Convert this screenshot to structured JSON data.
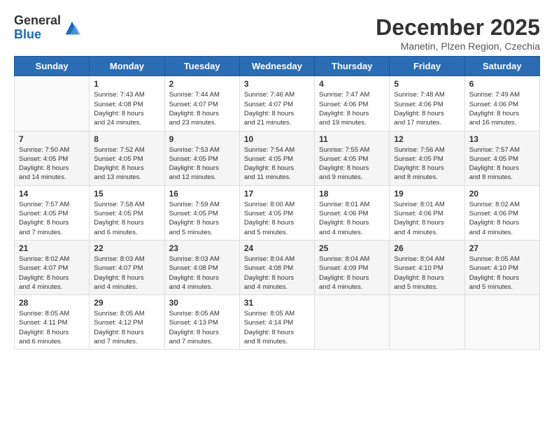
{
  "logo": {
    "general": "General",
    "blue": "Blue"
  },
  "title": "December 2025",
  "subtitle": "Manetin, Plzen Region, Czechia",
  "weekdays": [
    "Sunday",
    "Monday",
    "Tuesday",
    "Wednesday",
    "Thursday",
    "Friday",
    "Saturday"
  ],
  "weeks": [
    [
      {
        "day": "",
        "info": ""
      },
      {
        "day": "1",
        "info": "Sunrise: 7:43 AM\nSunset: 4:08 PM\nDaylight: 8 hours\nand 24 minutes."
      },
      {
        "day": "2",
        "info": "Sunrise: 7:44 AM\nSunset: 4:07 PM\nDaylight: 8 hours\nand 23 minutes."
      },
      {
        "day": "3",
        "info": "Sunrise: 7:46 AM\nSunset: 4:07 PM\nDaylight: 8 hours\nand 21 minutes."
      },
      {
        "day": "4",
        "info": "Sunrise: 7:47 AM\nSunset: 4:06 PM\nDaylight: 8 hours\nand 19 minutes."
      },
      {
        "day": "5",
        "info": "Sunrise: 7:48 AM\nSunset: 4:06 PM\nDaylight: 8 hours\nand 17 minutes."
      },
      {
        "day": "6",
        "info": "Sunrise: 7:49 AM\nSunset: 4:06 PM\nDaylight: 8 hours\nand 16 minutes."
      }
    ],
    [
      {
        "day": "7",
        "info": "Sunrise: 7:50 AM\nSunset: 4:05 PM\nDaylight: 8 hours\nand 14 minutes."
      },
      {
        "day": "8",
        "info": "Sunrise: 7:52 AM\nSunset: 4:05 PM\nDaylight: 8 hours\nand 13 minutes."
      },
      {
        "day": "9",
        "info": "Sunrise: 7:53 AM\nSunset: 4:05 PM\nDaylight: 8 hours\nand 12 minutes."
      },
      {
        "day": "10",
        "info": "Sunrise: 7:54 AM\nSunset: 4:05 PM\nDaylight: 8 hours\nand 11 minutes."
      },
      {
        "day": "11",
        "info": "Sunrise: 7:55 AM\nSunset: 4:05 PM\nDaylight: 8 hours\nand 9 minutes."
      },
      {
        "day": "12",
        "info": "Sunrise: 7:56 AM\nSunset: 4:05 PM\nDaylight: 8 hours\nand 8 minutes."
      },
      {
        "day": "13",
        "info": "Sunrise: 7:57 AM\nSunset: 4:05 PM\nDaylight: 8 hours\nand 8 minutes."
      }
    ],
    [
      {
        "day": "14",
        "info": "Sunrise: 7:57 AM\nSunset: 4:05 PM\nDaylight: 8 hours\nand 7 minutes."
      },
      {
        "day": "15",
        "info": "Sunrise: 7:58 AM\nSunset: 4:05 PM\nDaylight: 8 hours\nand 6 minutes."
      },
      {
        "day": "16",
        "info": "Sunrise: 7:59 AM\nSunset: 4:05 PM\nDaylight: 8 hours\nand 5 minutes."
      },
      {
        "day": "17",
        "info": "Sunrise: 8:00 AM\nSunset: 4:05 PM\nDaylight: 8 hours\nand 5 minutes."
      },
      {
        "day": "18",
        "info": "Sunrise: 8:01 AM\nSunset: 4:06 PM\nDaylight: 8 hours\nand 4 minutes."
      },
      {
        "day": "19",
        "info": "Sunrise: 8:01 AM\nSunset: 4:06 PM\nDaylight: 8 hours\nand 4 minutes."
      },
      {
        "day": "20",
        "info": "Sunrise: 8:02 AM\nSunset: 4:06 PM\nDaylight: 8 hours\nand 4 minutes."
      }
    ],
    [
      {
        "day": "21",
        "info": "Sunrise: 8:02 AM\nSunset: 4:07 PM\nDaylight: 8 hours\nand 4 minutes."
      },
      {
        "day": "22",
        "info": "Sunrise: 8:03 AM\nSunset: 4:07 PM\nDaylight: 8 hours\nand 4 minutes."
      },
      {
        "day": "23",
        "info": "Sunrise: 8:03 AM\nSunset: 4:08 PM\nDaylight: 8 hours\nand 4 minutes."
      },
      {
        "day": "24",
        "info": "Sunrise: 8:04 AM\nSunset: 4:08 PM\nDaylight: 8 hours\nand 4 minutes."
      },
      {
        "day": "25",
        "info": "Sunrise: 8:04 AM\nSunset: 4:09 PM\nDaylight: 8 hours\nand 4 minutes."
      },
      {
        "day": "26",
        "info": "Sunrise: 8:04 AM\nSunset: 4:10 PM\nDaylight: 8 hours\nand 5 minutes."
      },
      {
        "day": "27",
        "info": "Sunrise: 8:05 AM\nSunset: 4:10 PM\nDaylight: 8 hours\nand 5 minutes."
      }
    ],
    [
      {
        "day": "28",
        "info": "Sunrise: 8:05 AM\nSunset: 4:11 PM\nDaylight: 8 hours\nand 6 minutes."
      },
      {
        "day": "29",
        "info": "Sunrise: 8:05 AM\nSunset: 4:12 PM\nDaylight: 8 hours\nand 7 minutes."
      },
      {
        "day": "30",
        "info": "Sunrise: 8:05 AM\nSunset: 4:13 PM\nDaylight: 8 hours\nand 7 minutes."
      },
      {
        "day": "31",
        "info": "Sunrise: 8:05 AM\nSunset: 4:14 PM\nDaylight: 8 hours\nand 8 minutes."
      },
      {
        "day": "",
        "info": ""
      },
      {
        "day": "",
        "info": ""
      },
      {
        "day": "",
        "info": ""
      }
    ]
  ]
}
